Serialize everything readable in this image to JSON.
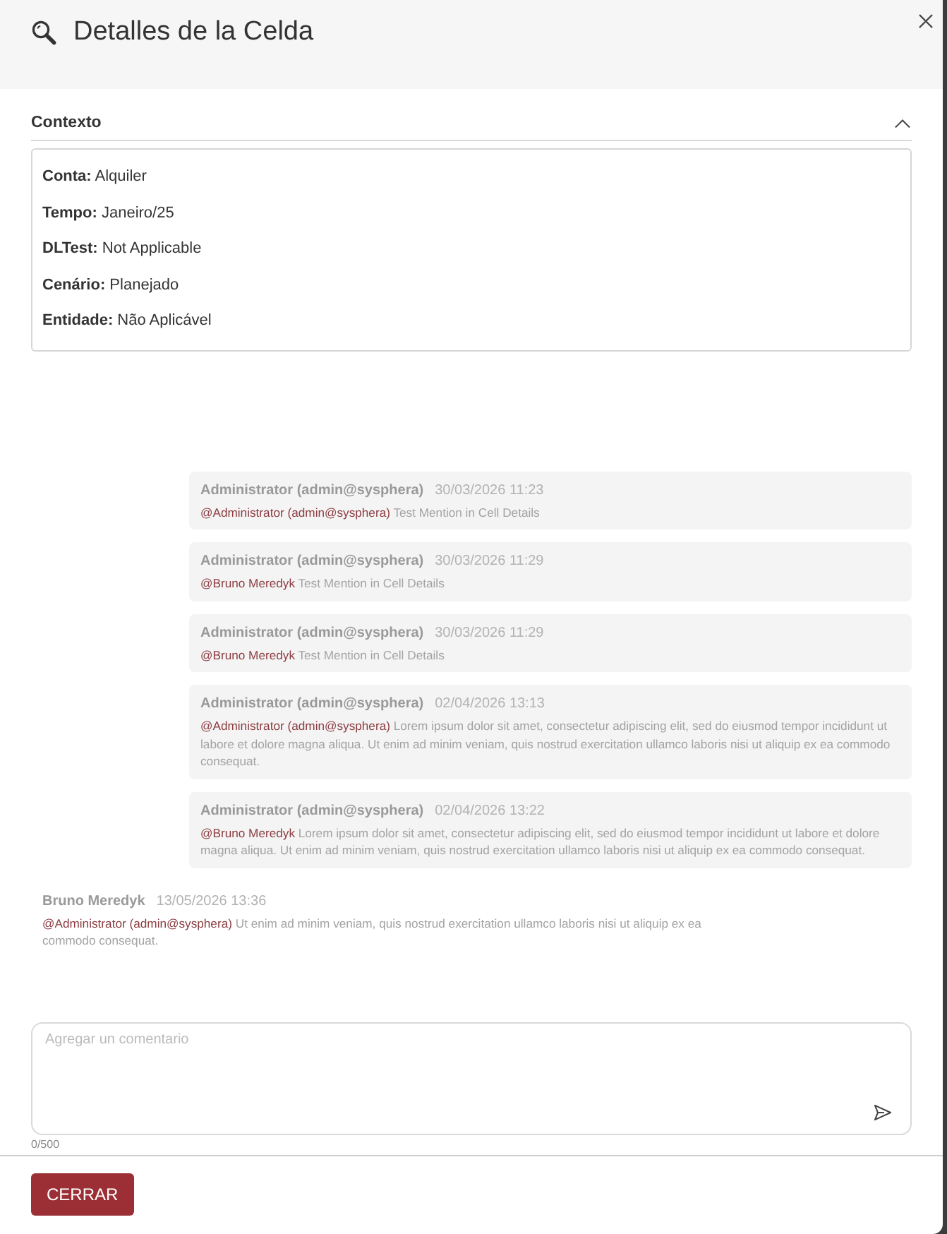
{
  "dialog": {
    "title": "Detalles de la Celda"
  },
  "context_section": {
    "title": "Contexto",
    "expanded": true,
    "fields": [
      "**Conta:** Alquiler",
      "**Tempo:** Janeiro/25",
      "**DLTest:** Not Applicable",
      "**Cenário:** Planejado",
      "**Entidade:** Não Aplicável"
    ]
  },
  "comments": [
    {
      "kind": "other",
      "author": "Administrator (admin@sysphera)",
      "date": "30/03/2026 11:23",
      "mention": "@Administrator (admin@sysphera)",
      "text": "Test Mention in Cell Details"
    },
    {
      "kind": "other",
      "author": "Administrator (admin@sysphera)",
      "date": "30/03/2026 11:29",
      "mention": "@Bruno Meredyk",
      "text": "Test Mention in Cell Details"
    },
    {
      "kind": "other",
      "author": "Administrator (admin@sysphera)",
      "date": "30/03/2026 11:29",
      "mention": "@Bruno Meredyk",
      "text": "Test Mention in Cell Details"
    },
    {
      "kind": "other",
      "author": "Administrator (admin@sysphera)",
      "date": "02/04/2026 13:13",
      "mention": "@Administrator (admin@sysphera)",
      "text": "Lorem ipsum dolor sit amet, consectetur adipiscing elit, sed do eiusmod tempor incididunt ut labore et dolore magna aliqua. Ut enim ad minim veniam, quis nostrud exercitation ullamco laboris nisi ut aliquip ex ea commodo consequat."
    },
    {
      "kind": "other",
      "author": "Administrator (admin@sysphera)",
      "date": "02/04/2026 13:22",
      "mention": "@Bruno Meredyk",
      "text": "Lorem ipsum dolor sit amet, consectetur adipiscing elit, sed do eiusmod tempor incididunt ut labore et dolore magna aliqua. Ut enim ad minim veniam, quis nostrud exercitation ullamco laboris nisi ut aliquip ex ea commodo consequat."
    },
    {
      "kind": "own",
      "author": "Bruno Meredyk",
      "date": "13/05/2026 13:36",
      "mention": "@Administrator (admin@sysphera)",
      "text": "Ut enim ad minim veniam, quis nostrud exercitation ullamco laboris nisi ut aliquip ex ea commodo consequat."
    }
  ],
  "comment_input": {
    "placeholder": "Agregar un comentario",
    "counter": "0/500"
  },
  "buttons": [
    {
      "label": "CERRAR"
    }
  ]
}
